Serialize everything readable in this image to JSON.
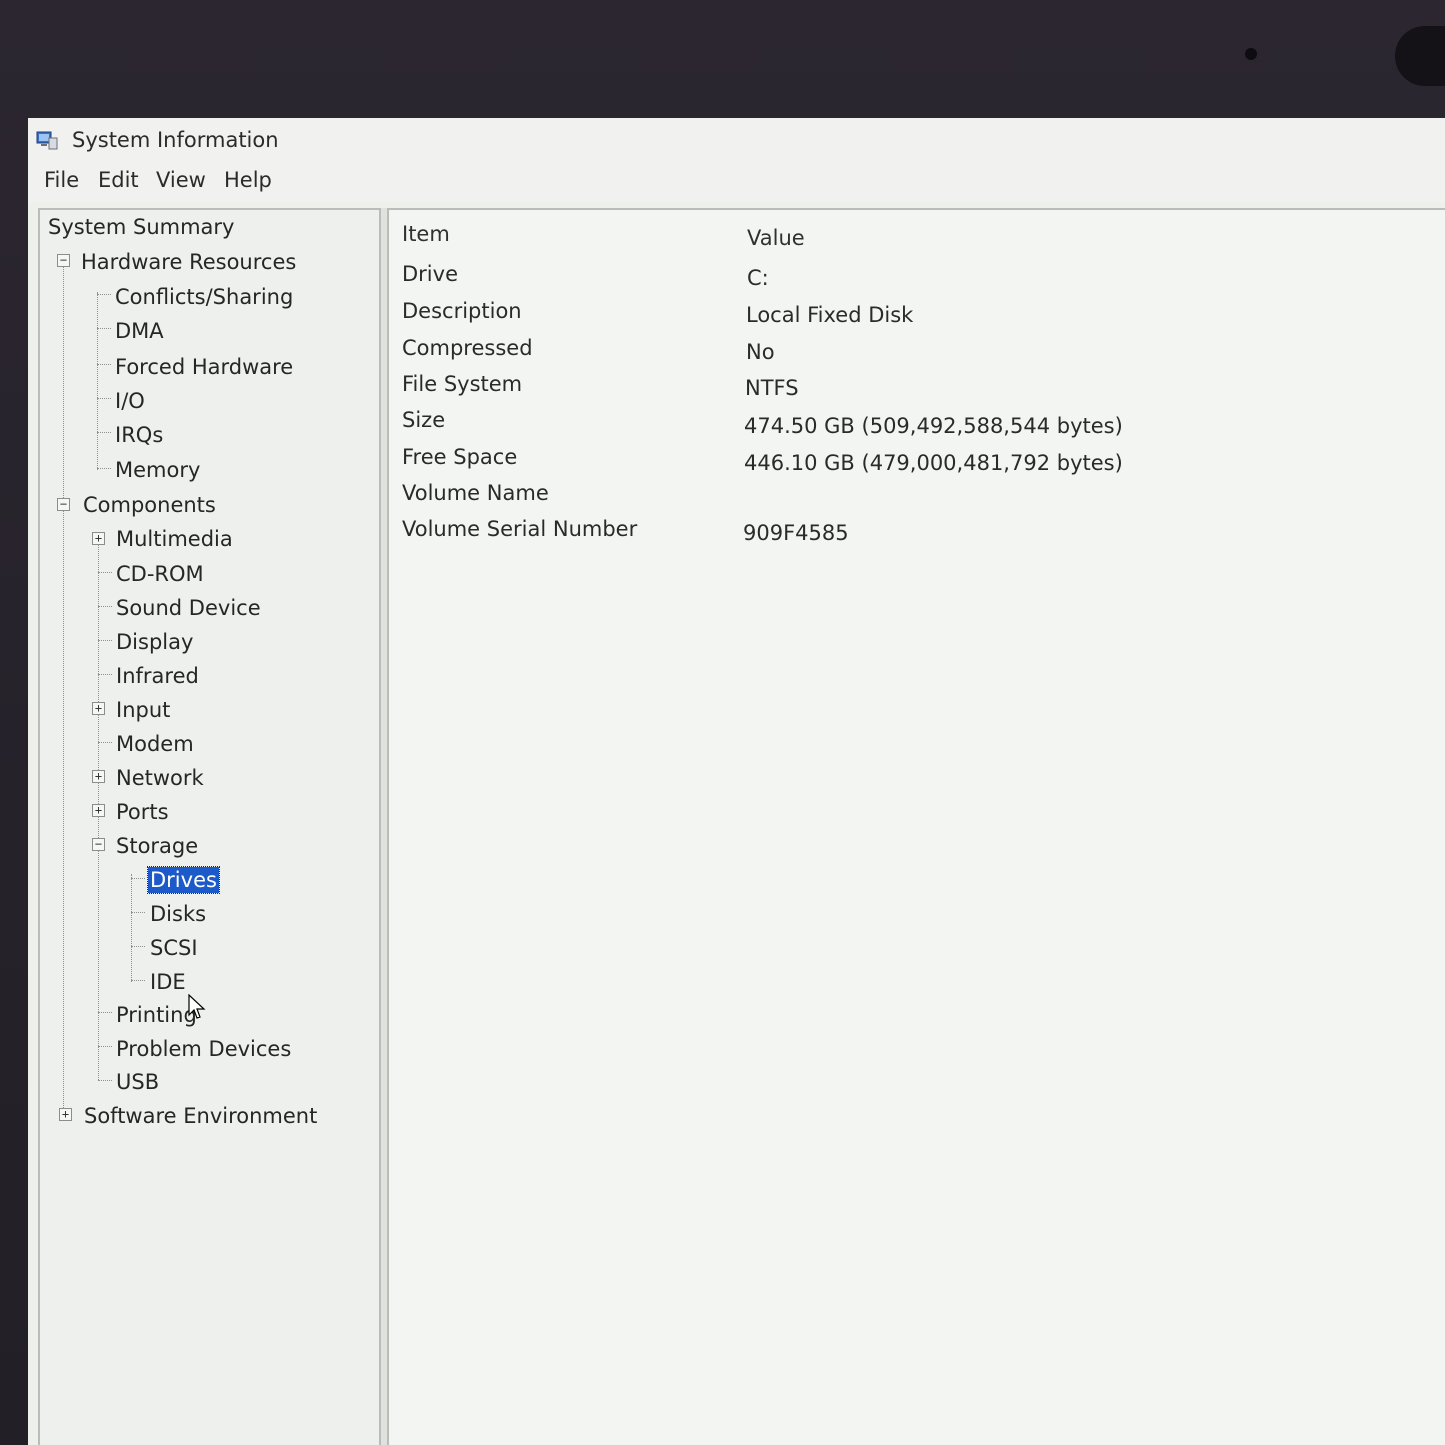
{
  "window": {
    "title": "System Information"
  },
  "menu": [
    {
      "label": "File"
    },
    {
      "label": "Edit"
    },
    {
      "label": "View"
    },
    {
      "label": "Help"
    }
  ],
  "tree": {
    "root": "System Summary",
    "hardware": {
      "label": "Hardware Resources",
      "toggle": "−",
      "children": [
        "Conflicts/Sharing",
        "DMA",
        "Forced Hardware",
        "I/O",
        "IRQs",
        "Memory"
      ]
    },
    "components": {
      "label": "Components",
      "toggle": "−",
      "children": [
        {
          "label": "Multimedia",
          "toggle": "+"
        },
        {
          "label": "CD-ROM"
        },
        {
          "label": "Sound Device"
        },
        {
          "label": "Display"
        },
        {
          "label": "Infrared"
        },
        {
          "label": "Input",
          "toggle": "+"
        },
        {
          "label": "Modem"
        },
        {
          "label": "Network",
          "toggle": "+"
        },
        {
          "label": "Ports",
          "toggle": "+"
        },
        {
          "label": "Storage",
          "toggle": "−"
        },
        {
          "label": "Printing"
        },
        {
          "label": "Problem Devices"
        },
        {
          "label": "USB"
        }
      ],
      "storage_children": [
        "Drives",
        "Disks",
        "SCSI",
        "IDE"
      ],
      "selected": "Drives"
    },
    "software": {
      "label": "Software Environment",
      "toggle": "+"
    }
  },
  "table": {
    "headers": {
      "item": "Item",
      "value": "Value"
    },
    "rows": [
      {
        "item": "Drive",
        "value": "C:"
      },
      {
        "item": "Description",
        "value": "Local Fixed Disk"
      },
      {
        "item": "Compressed",
        "value": "No"
      },
      {
        "item": "File System",
        "value": "NTFS"
      },
      {
        "item": "Size",
        "value": "474.50 GB (509,492,588,544 bytes)"
      },
      {
        "item": "Free Space",
        "value": "446.10 GB (479,000,481,792 bytes)"
      },
      {
        "item": "Volume Name",
        "value": ""
      },
      {
        "item": "Volume Serial Number",
        "value": "909F4585"
      }
    ]
  },
  "colors": {
    "selection": "#1c5ac9",
    "pane_background": "#f3f5f2"
  }
}
